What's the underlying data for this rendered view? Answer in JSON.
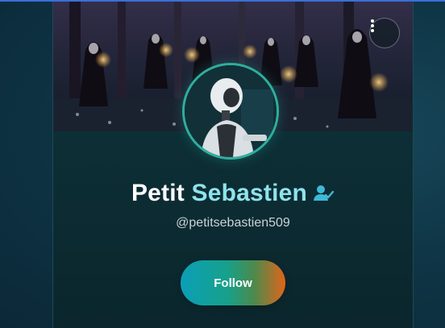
{
  "profile": {
    "first_name": "Petit",
    "last_name": "Sebastien",
    "handle": "@petitsebastien509",
    "verified": true
  },
  "actions": {
    "follow_label": "Follow",
    "more_menu_icon": "more-vertical-icon"
  },
  "colors": {
    "accent_name": "#8fe3ec",
    "verify_icon": "#3fb8d6",
    "follow_gradient": [
      "#0b9fb7",
      "#17a08a",
      "#e0651a"
    ],
    "avatar_ring": "#2fae9e"
  }
}
